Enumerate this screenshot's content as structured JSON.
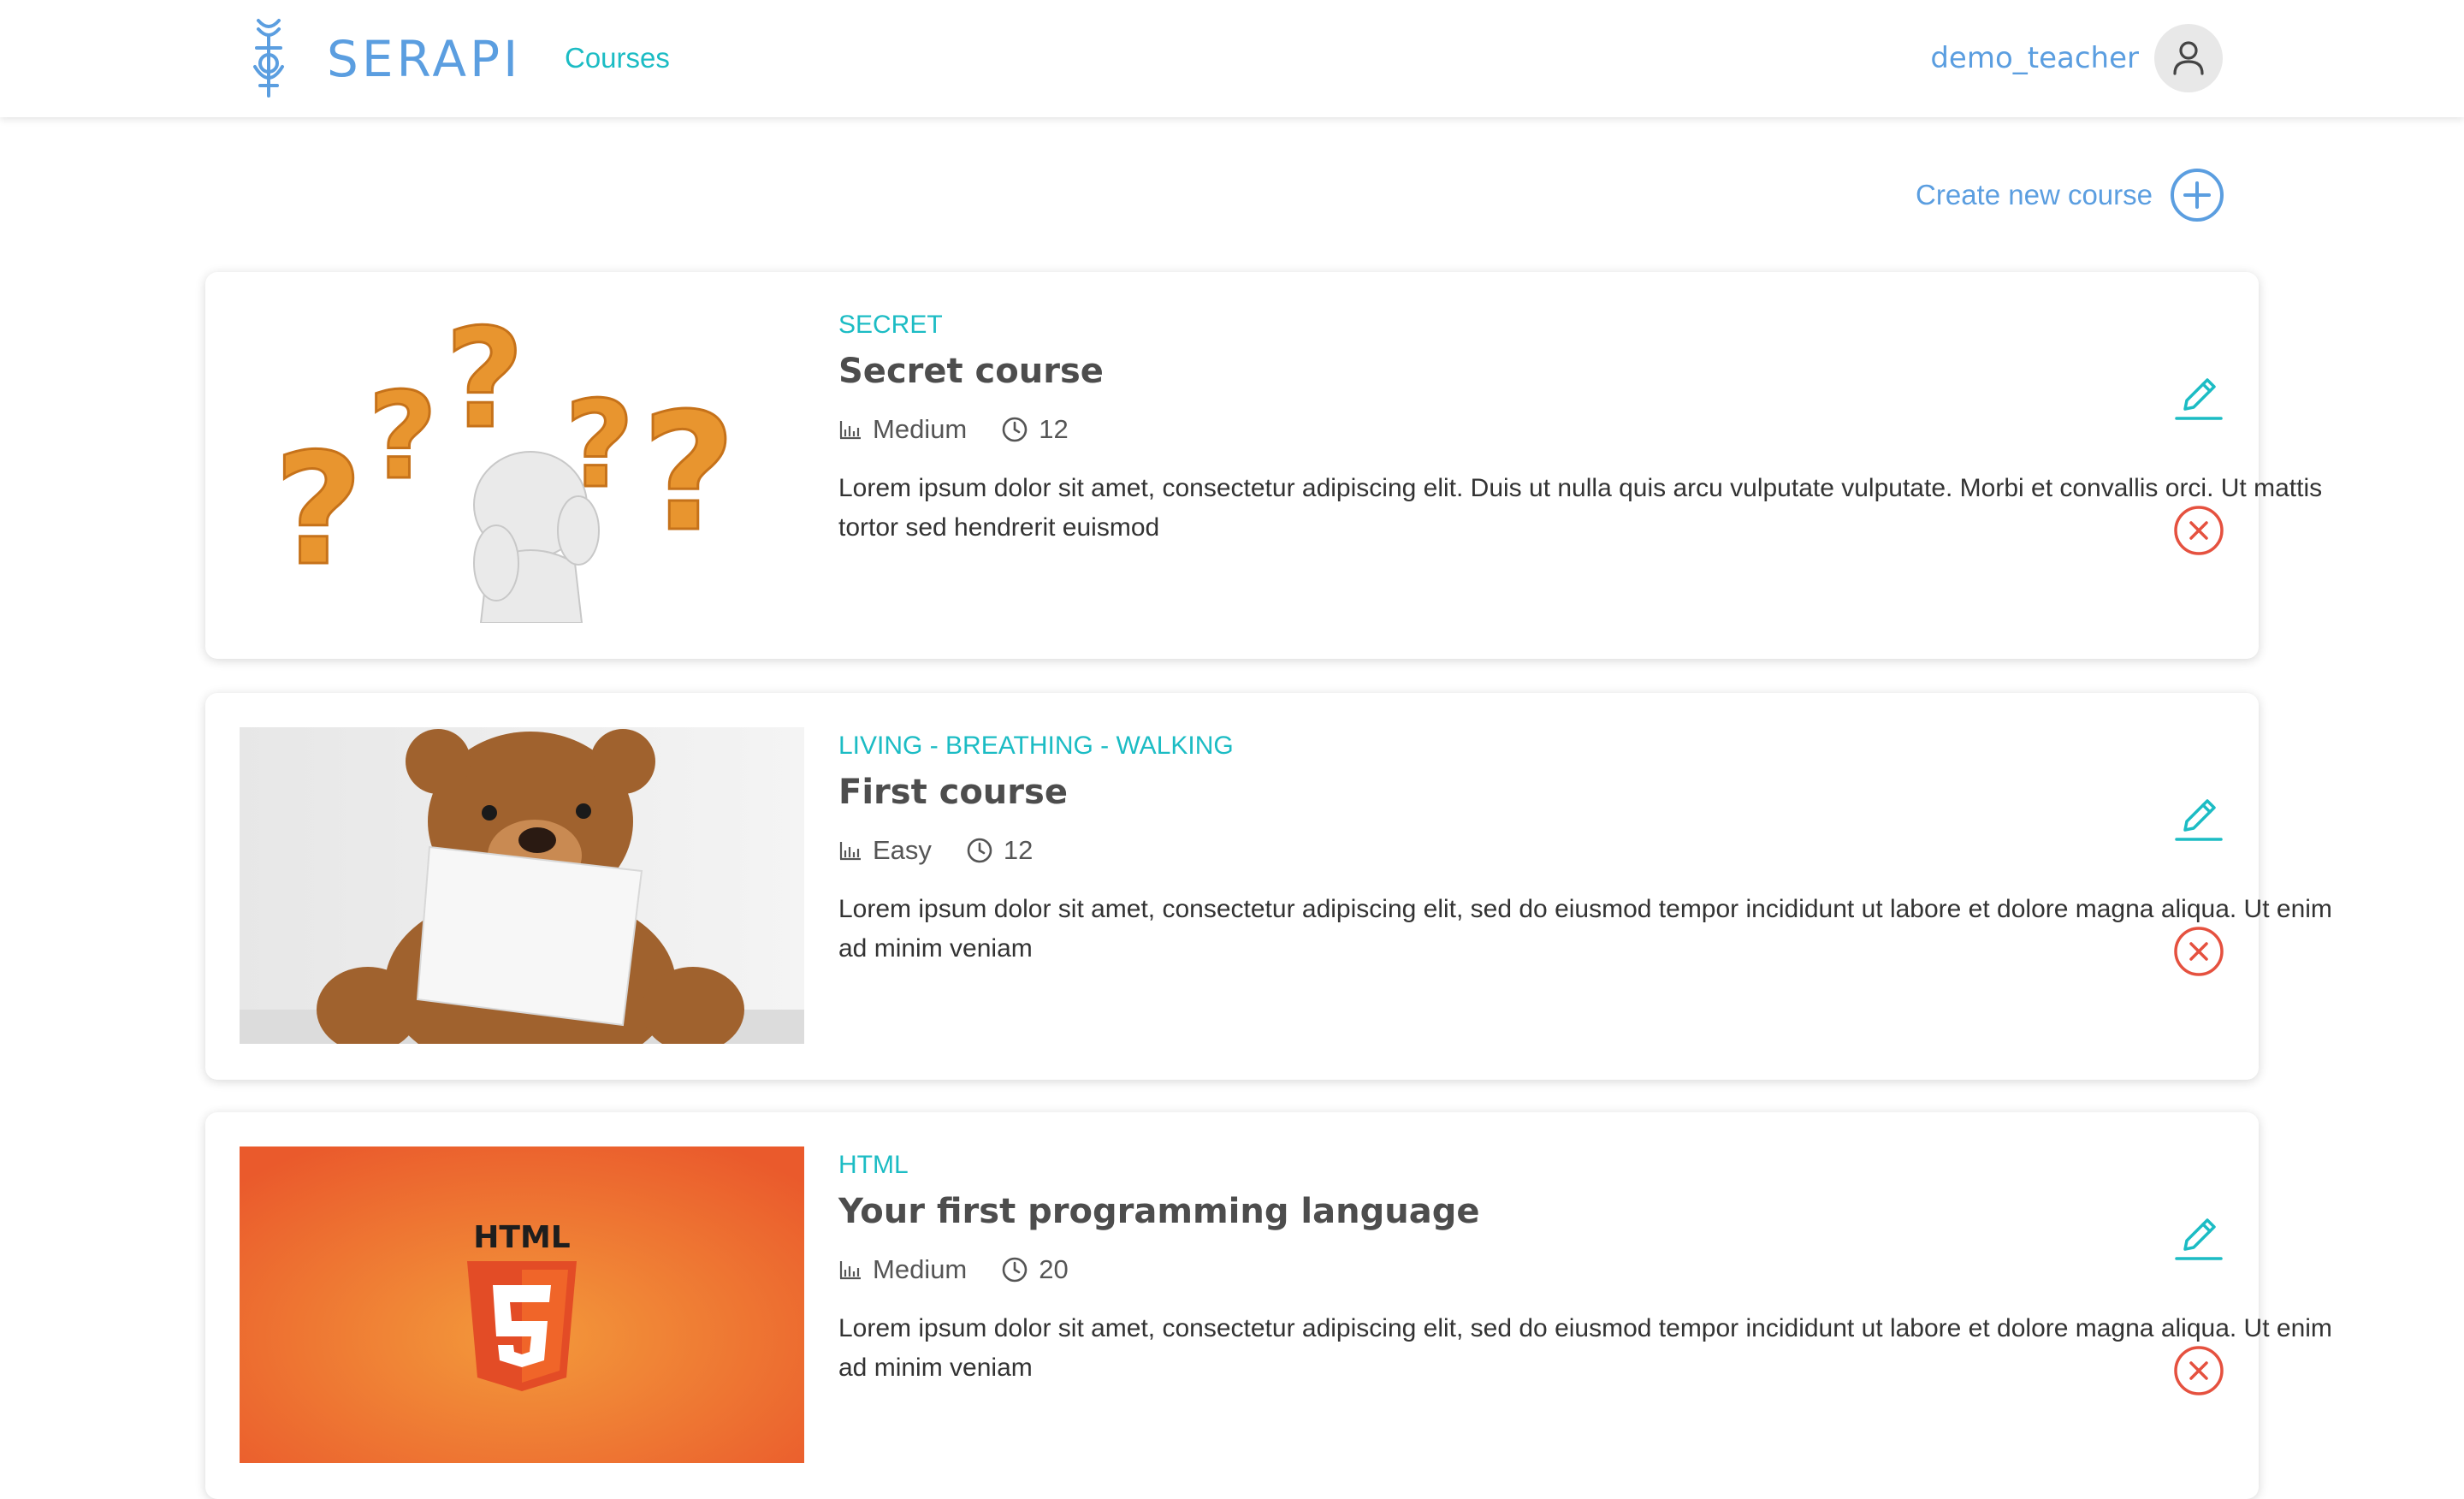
{
  "header": {
    "brand": "SERAPI",
    "nav": {
      "courses_label": "Courses"
    },
    "user": {
      "name": "demo_teacher"
    }
  },
  "actions": {
    "create_course_label": "Create new course"
  },
  "courses": [
    {
      "tag": "SECRET",
      "title": "Secret course",
      "difficulty": "Medium",
      "duration": "12",
      "description": "Lorem ipsum dolor sit amet, consectetur adipiscing elit. Duis ut nulla quis arcu vulputate vulputate. Morbi et convallis orci. Ut mattis tortor sed hendrerit euismod",
      "image": "question-marks-figure"
    },
    {
      "tag": "LIVING - BREATHING - WALKING",
      "title": "First course",
      "difficulty": "Easy",
      "duration": "12",
      "description": "Lorem ipsum dolor sit amet, consectetur adipiscing elit, sed do eiusmod tempor incididunt ut labore et dolore magna aliqua. Ut enim ad minim veniam",
      "image": "teddy-bear-with-sign"
    },
    {
      "tag": "HTML",
      "title": "Your first programming language",
      "difficulty": "Medium",
      "duration": "20",
      "description": "Lorem ipsum dolor sit amet, consectetur adipiscing elit, sed do eiusmod tempor incididunt ut labore et dolore magna aliqua. Ut enim ad minim veniam",
      "image": "html5-logo",
      "image_text": "HTML"
    }
  ],
  "colors": {
    "brand": "#5b9ee0",
    "accent": "#1cbcc4",
    "danger": "#e5513f",
    "title": "#4d4d4d"
  },
  "icons": {
    "difficulty": "bar-chart-icon",
    "duration": "clock-icon",
    "edit": "pencil-icon",
    "delete": "x-circle-icon",
    "create": "plus-circle-icon",
    "avatar": "user-icon"
  }
}
